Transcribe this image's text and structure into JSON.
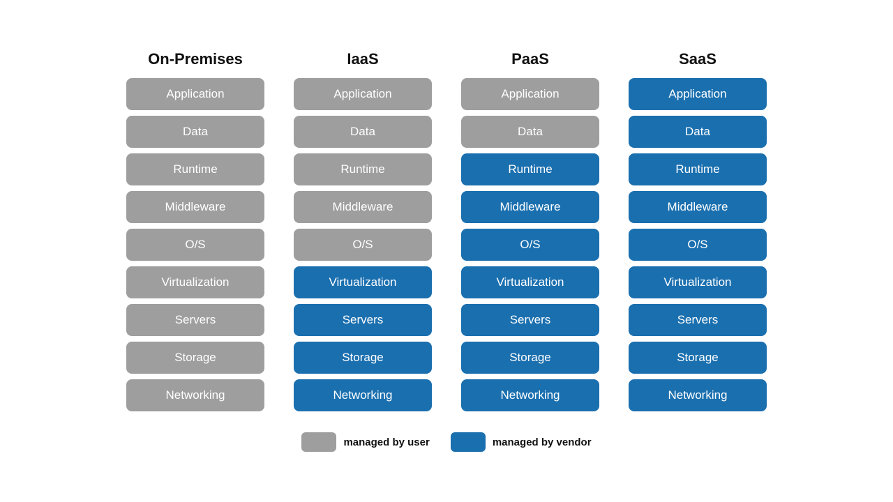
{
  "columns": [
    {
      "id": "on-premises",
      "header": "On-Premises",
      "tiers": [
        {
          "label": "Application",
          "managed": "user"
        },
        {
          "label": "Data",
          "managed": "user"
        },
        {
          "label": "Runtime",
          "managed": "user"
        },
        {
          "label": "Middleware",
          "managed": "user"
        },
        {
          "label": "O/S",
          "managed": "user"
        },
        {
          "label": "Virtualization",
          "managed": "user"
        },
        {
          "label": "Servers",
          "managed": "user"
        },
        {
          "label": "Storage",
          "managed": "user"
        },
        {
          "label": "Networking",
          "managed": "user"
        }
      ]
    },
    {
      "id": "iaas",
      "header": "IaaS",
      "tiers": [
        {
          "label": "Application",
          "managed": "user"
        },
        {
          "label": "Data",
          "managed": "user"
        },
        {
          "label": "Runtime",
          "managed": "user"
        },
        {
          "label": "Middleware",
          "managed": "user"
        },
        {
          "label": "O/S",
          "managed": "user"
        },
        {
          "label": "Virtualization",
          "managed": "vendor"
        },
        {
          "label": "Servers",
          "managed": "vendor"
        },
        {
          "label": "Storage",
          "managed": "vendor"
        },
        {
          "label": "Networking",
          "managed": "vendor"
        }
      ]
    },
    {
      "id": "paas",
      "header": "PaaS",
      "tiers": [
        {
          "label": "Application",
          "managed": "user"
        },
        {
          "label": "Data",
          "managed": "user"
        },
        {
          "label": "Runtime",
          "managed": "vendor"
        },
        {
          "label": "Middleware",
          "managed": "vendor"
        },
        {
          "label": "O/S",
          "managed": "vendor"
        },
        {
          "label": "Virtualization",
          "managed": "vendor"
        },
        {
          "label": "Servers",
          "managed": "vendor"
        },
        {
          "label": "Storage",
          "managed": "vendor"
        },
        {
          "label": "Networking",
          "managed": "vendor"
        }
      ]
    },
    {
      "id": "saas",
      "header": "SaaS",
      "tiers": [
        {
          "label": "Application",
          "managed": "vendor"
        },
        {
          "label": "Data",
          "managed": "vendor"
        },
        {
          "label": "Runtime",
          "managed": "vendor"
        },
        {
          "label": "Middleware",
          "managed": "vendor"
        },
        {
          "label": "O/S",
          "managed": "vendor"
        },
        {
          "label": "Virtualization",
          "managed": "vendor"
        },
        {
          "label": "Servers",
          "managed": "vendor"
        },
        {
          "label": "Storage",
          "managed": "vendor"
        },
        {
          "label": "Networking",
          "managed": "vendor"
        }
      ]
    }
  ],
  "legend": {
    "user_label": "managed by user",
    "vendor_label": "managed by vendor"
  }
}
